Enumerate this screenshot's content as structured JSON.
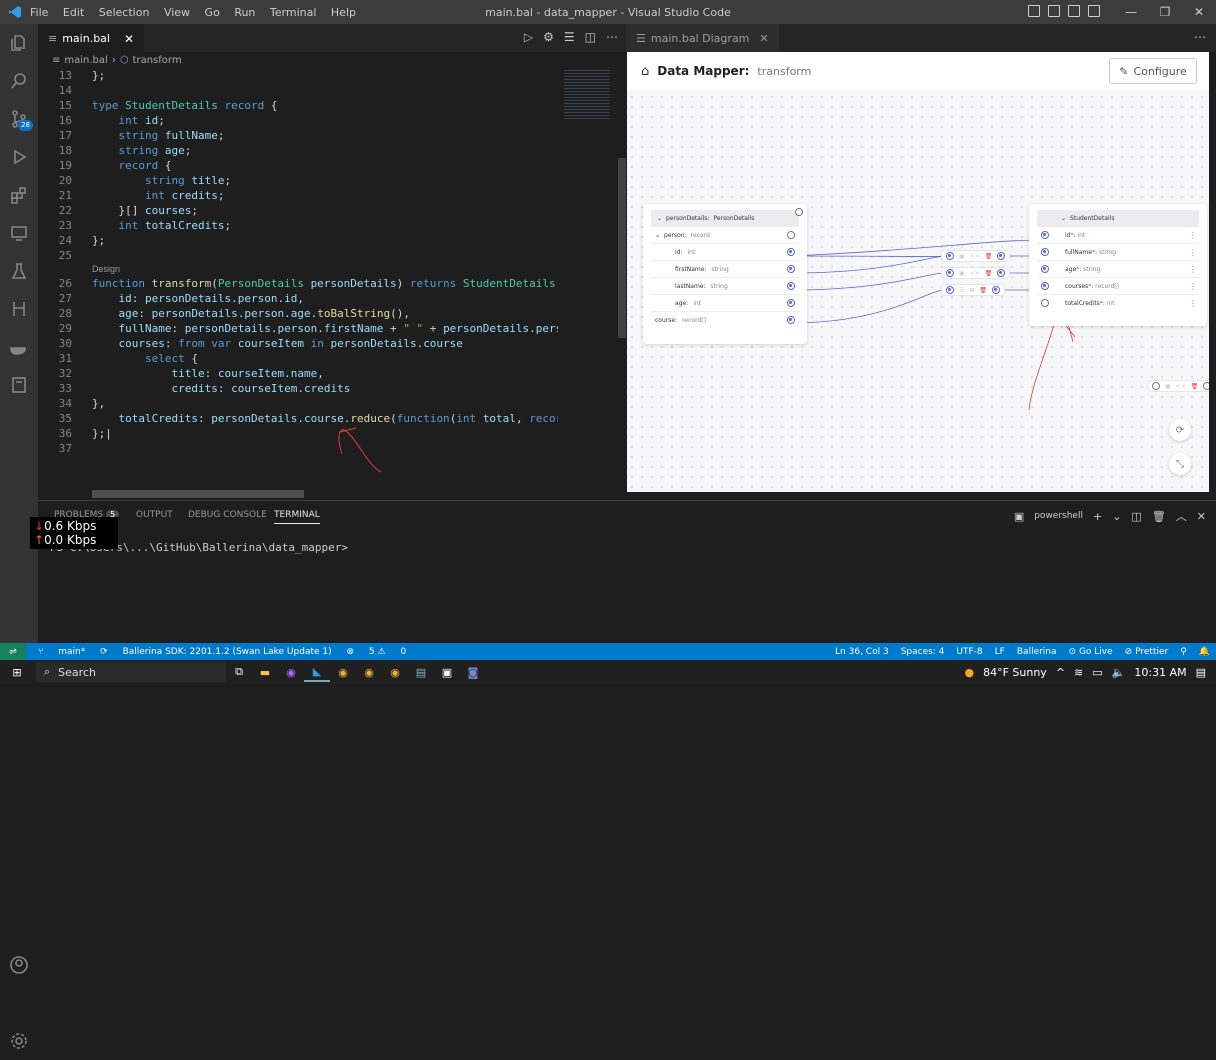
{
  "window": {
    "title": "main.bal - data_mapper - Visual Studio Code"
  },
  "menu": [
    "File",
    "Edit",
    "Selection",
    "View",
    "Go",
    "Run",
    "Terminal",
    "Help"
  ],
  "window_controls": {
    "minimize": "—",
    "maximize": "❐",
    "close": "✕"
  },
  "activity": {
    "scm_badge": "28"
  },
  "editor": {
    "tab_label": "main.bal",
    "breadcrumb_file": "main.bal",
    "breadcrumb_symbol": "transform",
    "code_lens": "Design",
    "lines": [
      {
        "n": "13",
        "html": "};"
      },
      {
        "n": "14",
        "html": ""
      },
      {
        "n": "15",
        "html": "<span class='tok-kw'>type</span> <span class='tok-ty'>StudentDetails</span> <span class='tok-kw'>record</span> {"
      },
      {
        "n": "16",
        "html": "    <span class='tok-kw'>int</span> <span class='tok-v'>id</span>;"
      },
      {
        "n": "17",
        "html": "    <span class='tok-kw'>string</span> <span class='tok-v'>fullName</span>;"
      },
      {
        "n": "18",
        "html": "    <span class='tok-kw'>string</span> <span class='tok-v'>age</span>;"
      },
      {
        "n": "19",
        "html": "    <span class='tok-kw'>record</span> {"
      },
      {
        "n": "20",
        "html": "        <span class='tok-kw'>string</span> <span class='tok-v'>title</span>;"
      },
      {
        "n": "21",
        "html": "        <span class='tok-kw'>int</span> <span class='tok-v'>credits</span>;"
      },
      {
        "n": "22",
        "html": "    }[] <span class='tok-v'>courses</span>;"
      },
      {
        "n": "23",
        "html": "    <span class='tok-kw'>int</span> <span class='tok-v'>totalCredits</span>;"
      },
      {
        "n": "24",
        "html": "};"
      },
      {
        "n": "25",
        "html": ""
      },
      {
        "n": "26",
        "html": "<span class='tok-kw'>function</span> <span class='tok-fn'>transform</span>(<span class='tok-ty'>PersonDetails</span> <span class='tok-v'>personDetails</span>) <span class='tok-kw'>returns</span> <span class='tok-ty'>StudentDetails</span> <span class='tok-kw'>=&gt;</span> {",
        "lens": true
      },
      {
        "n": "27",
        "html": "    <span class='tok-v'>id</span>: <span class='tok-v'>personDetails</span>.<span class='tok-v'>person</span>.<span class='tok-v'>id</span>,"
      },
      {
        "n": "28",
        "html": "    <span class='tok-v'>age</span>: <span class='tok-v'>personDetails</span>.<span class='tok-v'>person</span>.<span class='tok-v'>age</span>.<span class='tok-fn'>toBalString</span>(),"
      },
      {
        "n": "29",
        "html": "    <span class='tok-v'>fullName</span>: <span class='tok-v'>personDetails</span>.<span class='tok-v'>person</span>.<span class='tok-v'>firstName</span> + <span class='tok-s'>\" \"</span> + <span class='tok-v'>personDetails</span>.<span class='tok-v'>person</span>.<span class='tok-v'>las</span>"
      },
      {
        "n": "30",
        "html": "    <span class='tok-v'>courses</span>: <span class='tok-kw'>from</span> <span class='tok-kw'>var</span> <span class='tok-v'>courseItem</span> <span class='tok-kw'>in</span> <span class='tok-v'>personDetails</span>.<span class='tok-v'>course</span>"
      },
      {
        "n": "31",
        "html": "        <span class='tok-kw'>select</span> {"
      },
      {
        "n": "32",
        "html": "            <span class='tok-v'>title</span>: <span class='tok-v'>courseItem</span>.<span class='tok-v'>name</span>,"
      },
      {
        "n": "33",
        "html": "            <span class='tok-v'>credits</span>: <span class='tok-v'>courseItem</span>.<span class='tok-v'>credits</span>"
      },
      {
        "n": "34",
        "html": "},"
      },
      {
        "n": "35",
        "html": "    <span class='tok-v'>totalCredits</span>: <span class='tok-v'>personDetails</span>.<span class='tok-v'>course</span>.<span class='tok-fn'>reduce</span>(<span class='tok-kw'>function</span>(<span class='tok-kw'>int</span> <span class='tok-v'>total</span>, <span class='tok-kw'>record</span>{<span class='tok-kw'>stri</span>"
      },
      {
        "n": "36",
        "html": "};|"
      },
      {
        "n": "37",
        "html": ""
      }
    ]
  },
  "diagram": {
    "tab_label": "main.bal Diagram",
    "header_title": "Data Mapper:",
    "header_sub": "transform",
    "configure_label": "Configure",
    "source": {
      "header": "personDetails:",
      "header_type": "PersonDetails",
      "group": "person:",
      "group_type": "record",
      "fields": [
        {
          "name": "id:",
          "type": "int"
        },
        {
          "name": "firstName:",
          "type": "string"
        },
        {
          "name": "lastName:",
          "type": "string"
        },
        {
          "name": "age:",
          "type": "int"
        },
        {
          "name": "course:",
          "type": "record[]"
        }
      ]
    },
    "target": {
      "header": "StudentDetails",
      "fields": [
        {
          "name": "id",
          "type": "int"
        },
        {
          "name": "fullName",
          "type": "string"
        },
        {
          "name": "age",
          "type": "string"
        },
        {
          "name": "courses",
          "type": "record[]"
        },
        {
          "name": "totalCredits",
          "type": "int"
        }
      ]
    }
  },
  "panel": {
    "tabs": [
      "PROBLEMS",
      "OUTPUT",
      "DEBUG CONSOLE",
      "TERMINAL"
    ],
    "problems_count": "5",
    "shell": "powershell",
    "terminal_line": "PS C:\\Users\\...\\GitHub\\Ballerina\\data_mapper>"
  },
  "netspeed": {
    "down": "0.6 Kbps",
    "up": "0.0 Kbps"
  },
  "statusbar": {
    "branch": "main*",
    "sdk": "Ballerina SDK: 2201.1.2 (Swan Lake Update 1)",
    "errors": "5",
    "warnings": "0",
    "position": "Ln 36, Col 3",
    "spaces": "Spaces: 4",
    "encoding": "UTF-8",
    "eol": "LF",
    "language": "Ballerina",
    "golive": "Go Live",
    "prettier": "Prettier"
  },
  "taskbar": {
    "search": "Search",
    "weather": "84°F  Sunny",
    "time": "10:31 AM"
  },
  "colors": {
    "accent": "#007acc",
    "port": "#5567d5"
  }
}
